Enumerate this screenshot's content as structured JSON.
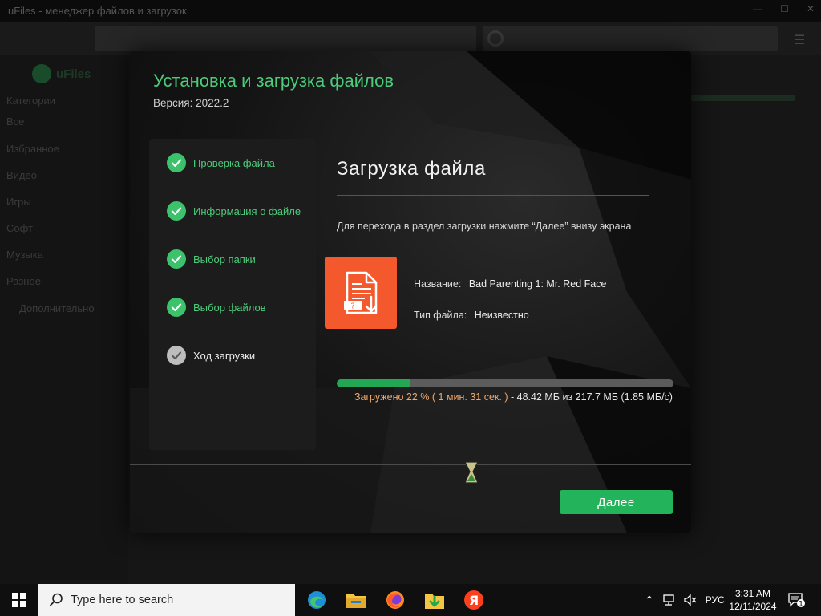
{
  "background_app": {
    "window_title": "uFiles - менеджер файлов и загрузок",
    "logo_text": "uFiles",
    "sidebar_heading": "Категории",
    "sidebar_items": [
      "Все",
      "Избранное",
      "Видео",
      "Игры",
      "Софт",
      "Музыка",
      "Разное"
    ],
    "sidebar_more": "Дополнительно"
  },
  "dialog": {
    "title": "Установка и загрузка файлов",
    "version": "Версия: 2022.2",
    "steps": [
      {
        "label": "Проверка файла",
        "status": "done"
      },
      {
        "label": "Информация о файле",
        "status": "done"
      },
      {
        "label": "Выбор папки",
        "status": "done"
      },
      {
        "label": "Выбор файлов",
        "status": "done"
      },
      {
        "label": "Ход загрузки",
        "status": "pending"
      }
    ],
    "main_title": "Загрузка файла",
    "instruction": "Для перехода в раздел загрузки нажмите “Далее” внизу экрана",
    "file": {
      "name_label": "Название:",
      "name_value": "Bad Parenting 1: Mr. Red Face",
      "type_label": "Тип файла:",
      "type_value": "Неизвестно"
    },
    "progress": {
      "percent": 22,
      "loaded_text": "Загружено 22 % ( 1 мин. 31 сек. )",
      "size_text": "- 48.42 МБ  из  217.7 МБ  (1.85 МБ/с)"
    },
    "next_button": "Далее"
  },
  "taskbar": {
    "search_placeholder": "Type here to search",
    "apps": [
      "edge-icon",
      "file-explorer-icon",
      "firefox-icon",
      "download-folder-icon",
      "yandex-browser-icon"
    ],
    "language": "РУС",
    "time": "3:31 AM",
    "date": "12/11/2024",
    "notification_count": "1"
  },
  "colors": {
    "accent_green": "#3cc26b",
    "title_green": "#4ccc7a",
    "file_icon_orange": "#f4592e",
    "progress_text_orange": "#f0a86a"
  }
}
